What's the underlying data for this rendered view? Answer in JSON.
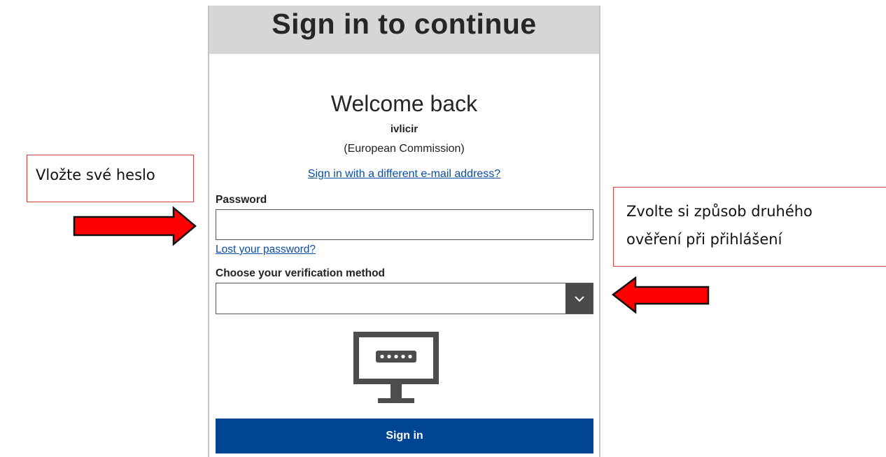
{
  "panel": {
    "title": "Sign in to continue",
    "welcome": "Welcome back",
    "username": "ivlicir",
    "organization": "(European Commission)",
    "different_email_link": "Sign in with a different e-mail address?",
    "password_label": "Password",
    "password_value": "",
    "lost_password_link": "Lost your password?",
    "verification_label": "Choose your verification method",
    "verification_selected": "",
    "signin_button": "Sign in",
    "colors": {
      "header_bg": "#d6d6d6",
      "link": "#0b4ea2",
      "signin_bg": "#004494"
    }
  },
  "annotations": {
    "password_hint": "Vložte své heslo",
    "verification_hint_line1": "Zvolte si způsob druhého",
    "verification_hint_line2": "ověření při přihlášení",
    "arrow_color": "#ff0000",
    "icons": [
      "right-arrow-icon",
      "left-arrow-icon"
    ]
  }
}
